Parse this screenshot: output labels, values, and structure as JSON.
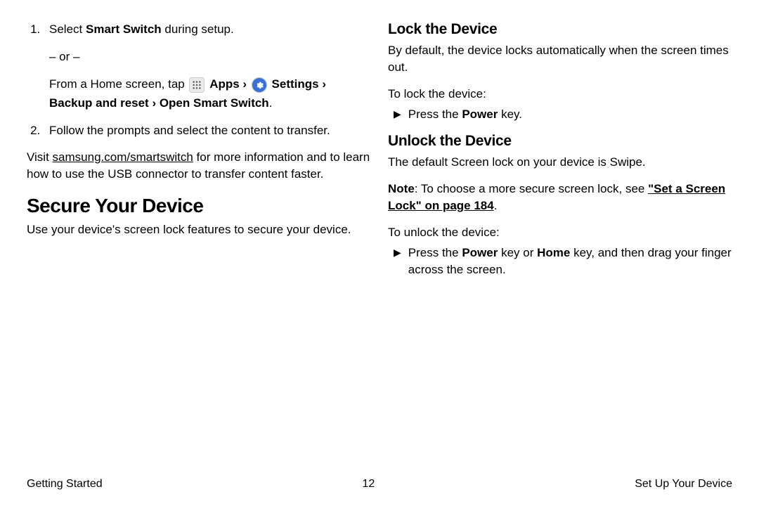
{
  "left": {
    "ol": {
      "item1": {
        "a": "Select ",
        "b": "Smart Switch",
        "c": " during setup."
      },
      "or": "– or –",
      "home_path": {
        "a": "From a Home screen, tap ",
        "apps": " Apps › ",
        "settings": " Settings › Backup and reset › Open Smart Switch",
        "dot": "."
      },
      "item2": "Follow the prompts and select the content to transfer."
    },
    "visit": {
      "a": "Visit ",
      "link": "samsung.com/smartswitch",
      "b": " for more information and to learn how to use the USB connector to transfer content faster."
    },
    "h1": "Secure Your Device",
    "h1_sub": "Use your device's screen lock features to secure your device."
  },
  "right": {
    "lock_h2": "Lock the Device",
    "lock_p": "By default, the device locks automatically when the screen times out.",
    "lock_lead": "To lock the device:",
    "lock_bullet": {
      "a": "Press the ",
      "b": "Power",
      "c": " key."
    },
    "unlock_h2": "Unlock the Device",
    "unlock_p": "The default Screen lock on your device is Swipe.",
    "note": {
      "a": "Note",
      "b": ": To choose a more secure screen lock, see ",
      "link": "\"Set a Screen Lock\" on page 184",
      "c": "."
    },
    "unlock_lead": "To unlock the device:",
    "unlock_bullet": {
      "a": "Press the ",
      "b": "Power",
      "c": " key or ",
      "d": "Home",
      "e": " key, and then drag your finger across the screen."
    }
  },
  "footer": {
    "left": "Getting Started",
    "center": "12",
    "right": "Set Up Your Device"
  }
}
